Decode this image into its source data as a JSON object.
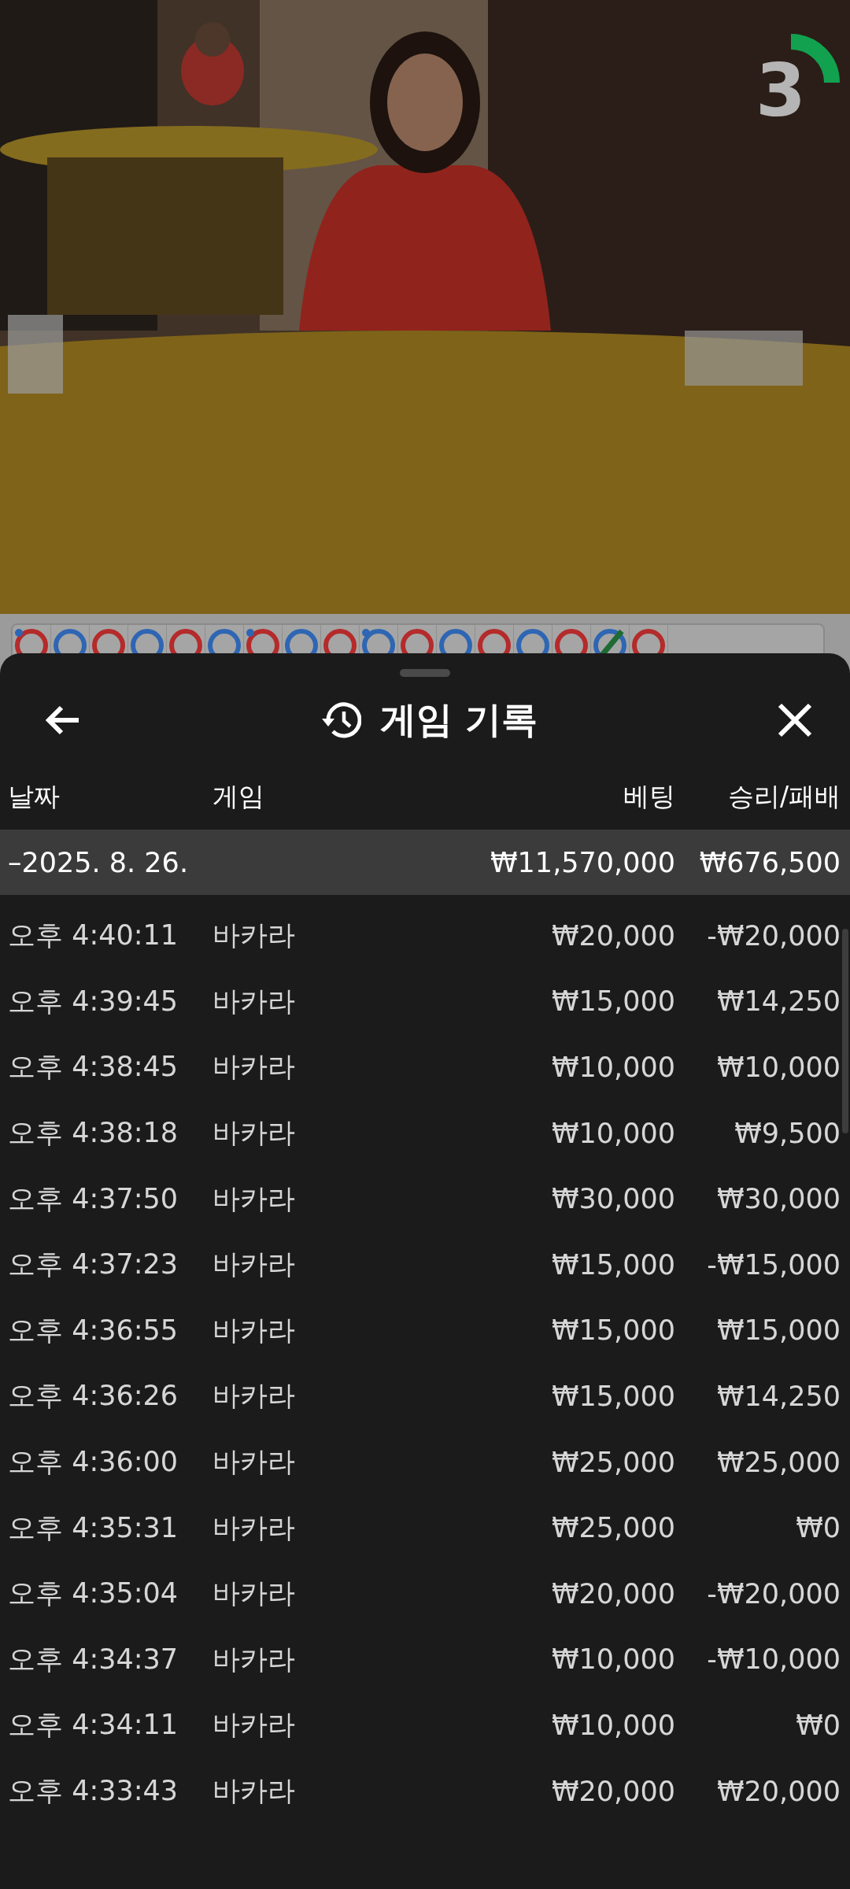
{
  "video": {
    "kind": "picture",
    "countdown": {
      "value": "3"
    }
  },
  "bead_road": [
    {
      "color": "#b52a2a",
      "kind": "ring",
      "pair": true
    },
    {
      "color": "#2f66b3",
      "kind": "ring",
      "pair": false
    },
    {
      "color": "#b52a2a",
      "kind": "ring",
      "pair": false
    },
    {
      "color": "#2f66b3",
      "kind": "ring",
      "pair": false
    },
    {
      "color": "#b52a2a",
      "kind": "ring",
      "pair": false
    },
    {
      "color": "#2f66b3",
      "kind": "ring",
      "pair": false
    },
    {
      "color": "#b52a2a",
      "kind": "ring",
      "pair": true
    },
    {
      "color": "#2f66b3",
      "kind": "ring",
      "pair": false
    },
    {
      "color": "#b52a2a",
      "kind": "ring",
      "pair": false
    },
    {
      "color": "#2f66b3",
      "kind": "ring",
      "pair": true
    },
    {
      "color": "#b52a2a",
      "kind": "ring",
      "pair": false
    },
    {
      "color": "#2f66b3",
      "kind": "ring",
      "pair": false
    },
    {
      "color": "#b52a2a",
      "kind": "ring",
      "pair": false
    },
    {
      "color": "#2f66b3",
      "kind": "ring",
      "pair": false
    },
    {
      "color": "#b52a2a",
      "kind": "ring",
      "pair": false
    },
    {
      "color": "#2f66b3",
      "kind": "tie",
      "pair": false
    },
    {
      "color": "#b52a2a",
      "kind": "ring",
      "pair": false
    }
  ],
  "sheet": {
    "title": "게임 기록",
    "columns": [
      "날짜",
      "게임",
      "베팅",
      "승리/패배"
    ],
    "summary": {
      "date": "–2025. 8. 26.",
      "bet": "₩11,570,000",
      "result": "₩676,500"
    },
    "rows": [
      {
        "time": "오후 4:40:11",
        "game": "바카라",
        "bet": "₩20,000",
        "result": "-₩20,000"
      },
      {
        "time": "오후 4:39:45",
        "game": "바카라",
        "bet": "₩15,000",
        "result": "₩14,250"
      },
      {
        "time": "오후 4:38:45",
        "game": "바카라",
        "bet": "₩10,000",
        "result": "₩10,000"
      },
      {
        "time": "오후 4:38:18",
        "game": "바카라",
        "bet": "₩10,000",
        "result": "₩9,500"
      },
      {
        "time": "오후 4:37:50",
        "game": "바카라",
        "bet": "₩30,000",
        "result": "₩30,000"
      },
      {
        "time": "오후 4:37:23",
        "game": "바카라",
        "bet": "₩15,000",
        "result": "-₩15,000"
      },
      {
        "time": "오후 4:36:55",
        "game": "바카라",
        "bet": "₩15,000",
        "result": "₩15,000"
      },
      {
        "time": "오후 4:36:26",
        "game": "바카라",
        "bet": "₩15,000",
        "result": "₩14,250"
      },
      {
        "time": "오후 4:36:00",
        "game": "바카라",
        "bet": "₩25,000",
        "result": "₩25,000"
      },
      {
        "time": "오후 4:35:31",
        "game": "바카라",
        "bet": "₩25,000",
        "result": "₩0"
      },
      {
        "time": "오후 4:35:04",
        "game": "바카라",
        "bet": "₩20,000",
        "result": "-₩20,000"
      },
      {
        "time": "오후 4:34:37",
        "game": "바카라",
        "bet": "₩10,000",
        "result": "-₩10,000"
      },
      {
        "time": "오후 4:34:11",
        "game": "바카라",
        "bet": "₩10,000",
        "result": "₩0"
      },
      {
        "time": "오후 4:33:43",
        "game": "바카라",
        "bet": "₩20,000",
        "result": "₩20,000"
      }
    ]
  }
}
